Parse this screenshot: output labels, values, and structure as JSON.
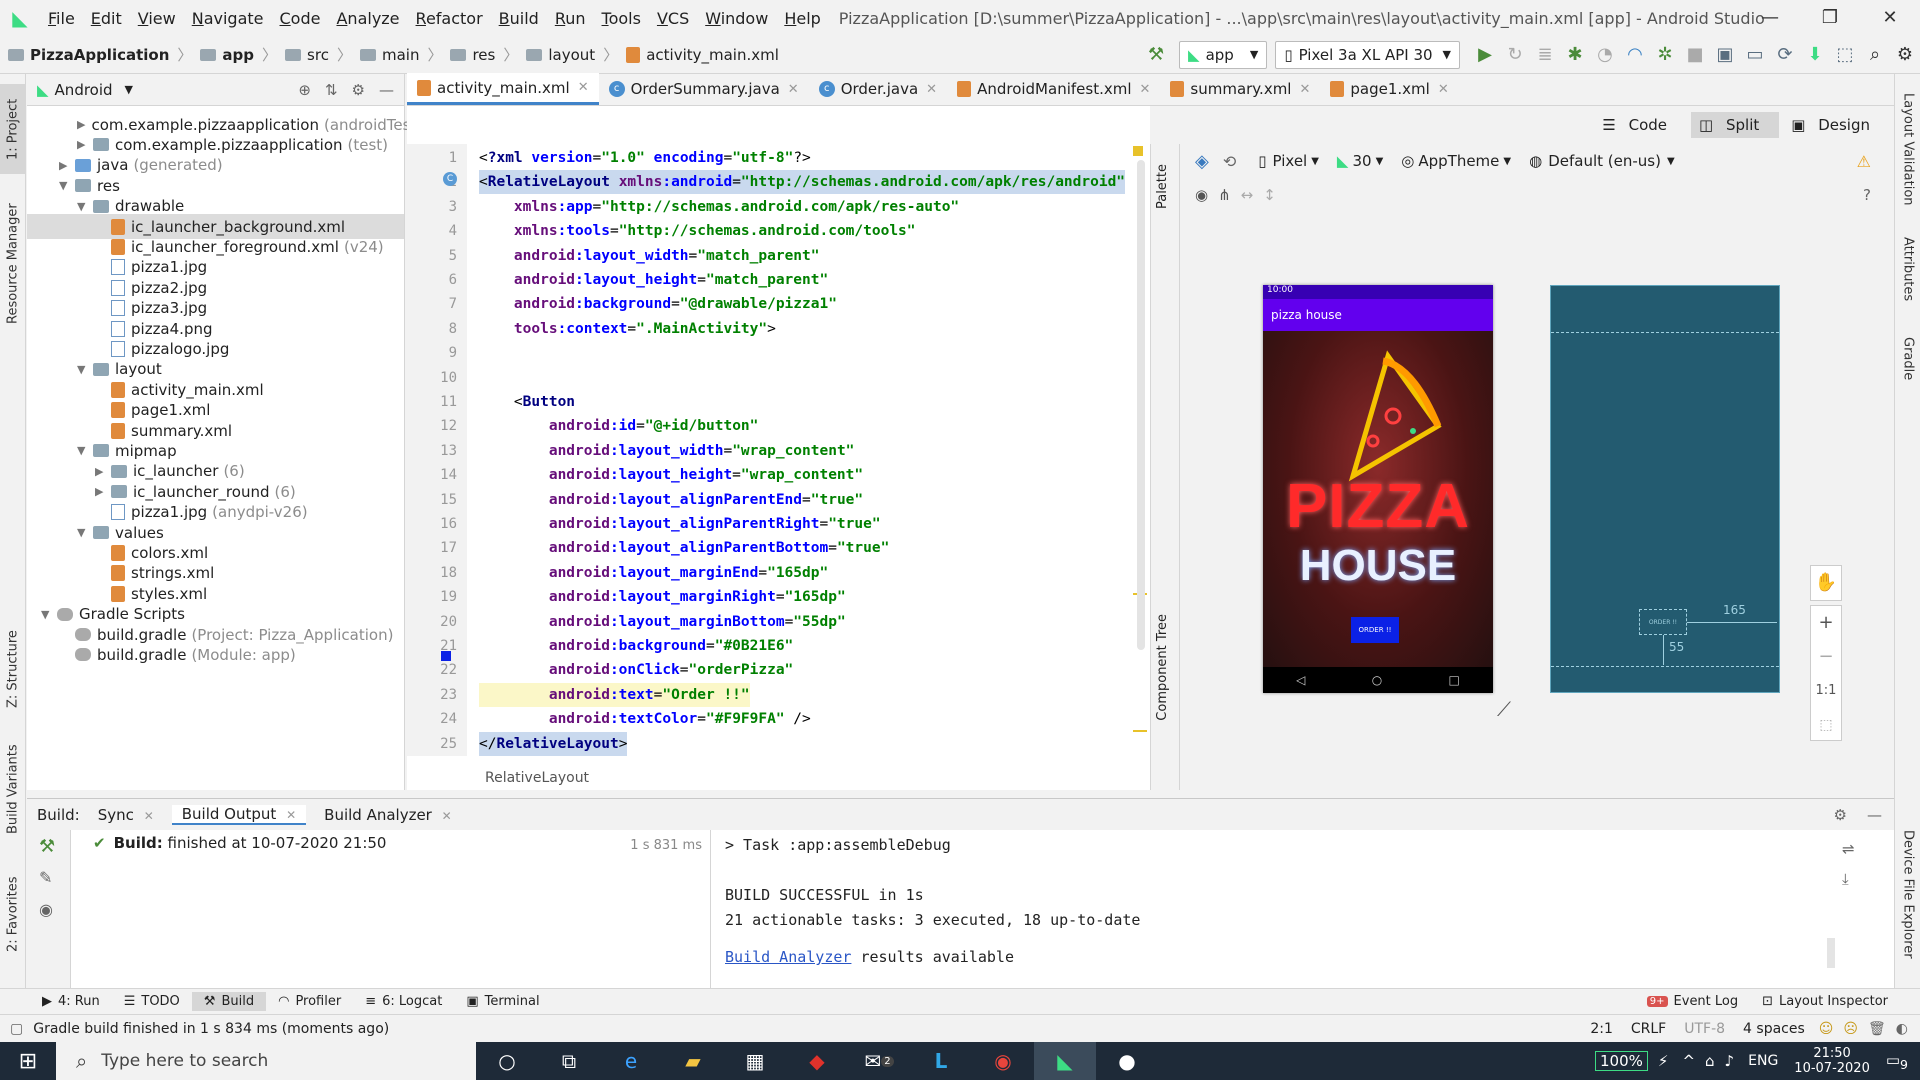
{
  "window": {
    "title": "PizzaApplication [D:\\summer\\PizzaApplication] - ...\\app\\src\\main\\res\\layout\\activity_main.xml [app] - Android Studio"
  },
  "menu": [
    "File",
    "Edit",
    "View",
    "Navigate",
    "Code",
    "Analyze",
    "Refactor",
    "Build",
    "Run",
    "Tools",
    "VCS",
    "Window",
    "Help"
  ],
  "breadcrumb": [
    "PizzaApplication",
    "app",
    "src",
    "main",
    "res",
    "layout",
    "activity_main.xml"
  ],
  "toolbar": {
    "run_config": "app",
    "device": "Pixel 3a XL API 30"
  },
  "project_panel": {
    "view": "Android",
    "tree": [
      {
        "label": "com.example.pizzaapplication",
        "hint": "(androidTest)",
        "indent": 1,
        "arrow": "▶",
        "type": "pkg"
      },
      {
        "label": "com.example.pizzaapplication",
        "hint": "(test)",
        "indent": 1,
        "arrow": "▶",
        "type": "pkg"
      },
      {
        "label": "java",
        "hint": "(generated)",
        "indent": 0,
        "arrow": "▶",
        "type": "jv"
      },
      {
        "label": "res",
        "hint": "",
        "indent": 0,
        "arrow": "▼",
        "type": "pkg"
      },
      {
        "label": "drawable",
        "hint": "",
        "indent": 1,
        "arrow": "▼",
        "type": "pkg"
      },
      {
        "label": "ic_launcher_background.xml",
        "hint": "",
        "indent": 2,
        "arrow": "",
        "type": "xml",
        "selected": true
      },
      {
        "label": "ic_launcher_foreground.xml",
        "hint": "(v24)",
        "indent": 2,
        "arrow": "",
        "type": "xml"
      },
      {
        "label": "pizza1.jpg",
        "hint": "",
        "indent": 2,
        "arrow": "",
        "type": "img"
      },
      {
        "label": "pizza2.jpg",
        "hint": "",
        "indent": 2,
        "arrow": "",
        "type": "img"
      },
      {
        "label": "pizza3.jpg",
        "hint": "",
        "indent": 2,
        "arrow": "",
        "type": "img"
      },
      {
        "label": "pizza4.png",
        "hint": "",
        "indent": 2,
        "arrow": "",
        "type": "img"
      },
      {
        "label": "pizzalogo.jpg",
        "hint": "",
        "indent": 2,
        "arrow": "",
        "type": "img"
      },
      {
        "label": "layout",
        "hint": "",
        "indent": 1,
        "arrow": "▼",
        "type": "pkg"
      },
      {
        "label": "activity_main.xml",
        "hint": "",
        "indent": 2,
        "arrow": "",
        "type": "xml"
      },
      {
        "label": "page1.xml",
        "hint": "",
        "indent": 2,
        "arrow": "",
        "type": "xml"
      },
      {
        "label": "summary.xml",
        "hint": "",
        "indent": 2,
        "arrow": "",
        "type": "xml"
      },
      {
        "label": "mipmap",
        "hint": "",
        "indent": 1,
        "arrow": "▼",
        "type": "pkg"
      },
      {
        "label": "ic_launcher",
        "hint": "(6)",
        "indent": 2,
        "arrow": "▶",
        "type": "pkg"
      },
      {
        "label": "ic_launcher_round",
        "hint": "(6)",
        "indent": 2,
        "arrow": "▶",
        "type": "pkg"
      },
      {
        "label": "pizza1.jpg",
        "hint": "(anydpi-v26)",
        "indent": 2,
        "arrow": "",
        "type": "img"
      },
      {
        "label": "values",
        "hint": "",
        "indent": 1,
        "arrow": "▼",
        "type": "pkg"
      },
      {
        "label": "colors.xml",
        "hint": "",
        "indent": 2,
        "arrow": "",
        "type": "xml"
      },
      {
        "label": "strings.xml",
        "hint": "",
        "indent": 2,
        "arrow": "",
        "type": "xml"
      },
      {
        "label": "styles.xml",
        "hint": "",
        "indent": 2,
        "arrow": "",
        "type": "xml"
      },
      {
        "label": "Gradle Scripts",
        "hint": "",
        "indent": -1,
        "arrow": "▼",
        "type": "gr"
      },
      {
        "label": "build.gradle",
        "hint": "(Project: Pizza_Application)",
        "indent": 0,
        "arrow": "",
        "type": "gr"
      },
      {
        "label": "build.gradle",
        "hint": "(Module: app)",
        "indent": 0,
        "arrow": "",
        "type": "gr"
      }
    ]
  },
  "editor_tabs": [
    {
      "label": "activity_main.xml",
      "active": true,
      "icon": "xml"
    },
    {
      "label": "OrderSummary.java",
      "active": false,
      "icon": "c"
    },
    {
      "label": "Order.java",
      "active": false,
      "icon": "c"
    },
    {
      "label": "AndroidManifest.xml",
      "active": false,
      "icon": "xml"
    },
    {
      "label": "summary.xml",
      "active": false,
      "icon": "xml"
    },
    {
      "label": "page1.xml",
      "active": false,
      "icon": "xml"
    }
  ],
  "view_modes": [
    "Code",
    "Split",
    "Design"
  ],
  "code_lines": [
    "<?xml version=\"1.0\" encoding=\"utf-8\"?>",
    "<RelativeLayout xmlns:android=\"http://schemas.android.com/apk/res/android\"",
    "    xmlns:app=\"http://schemas.android.com/apk/res-auto\"",
    "    xmlns:tools=\"http://schemas.android.com/tools\"",
    "    android:layout_width=\"match_parent\"",
    "    android:layout_height=\"match_parent\"",
    "    android:background=\"@drawable/pizza1\"",
    "    tools:context=\".MainActivity\">",
    "",
    "",
    "    <Button",
    "        android:id=\"@+id/button\"",
    "        android:layout_width=\"wrap_content\"",
    "        android:layout_height=\"wrap_content\"",
    "        android:layout_alignParentEnd=\"true\"",
    "        android:layout_alignParentRight=\"true\"",
    "        android:layout_alignParentBottom=\"true\"",
    "        android:layout_marginEnd=\"165dp\"",
    "        android:layout_marginRight=\"165dp\"",
    "        android:layout_marginBottom=\"55dp\"",
    "        android:background=\"#0B21E6\"",
    "        android:onClick=\"orderPizza\"",
    "        android:text=\"Order !!\"",
    "        android:textColor=\"#F9F9FA\" />",
    "</RelativeLayout>"
  ],
  "code_status": "RelativeLayout",
  "design": {
    "palette": "Palette",
    "component_tree": "Component Tree",
    "device": "Pixel",
    "api": "30",
    "theme": "AppTheme",
    "locale": "Default (en-us)",
    "zoom_ratio": "1:1"
  },
  "preview": {
    "time": "10:00",
    "app_title": "pizza house",
    "line1": "PIZZA",
    "line2": "HOUSE",
    "button": "ORDER !!"
  },
  "blueprint": {
    "margin_end": "165",
    "margin_bottom": "55",
    "button": "ORDER !!"
  },
  "build_panel": {
    "label": "Build:",
    "tabs": [
      "Sync",
      "Build Output",
      "Build Analyzer"
    ],
    "status_bold": "Build:",
    "status": "finished at 10-07-2020 21:50",
    "duration": "1 s 831 ms",
    "output": [
      "> Task :app:assembleDebug",
      "",
      "BUILD SUCCESSFUL in 1s",
      "21 actionable tasks: 3 executed, 18 up-to-date",
      ""
    ],
    "analyzer_link": "Build Analyzer",
    "analyzer_rest": " results available"
  },
  "tool_tabs": [
    "4: Run",
    "TODO",
    "Build",
    "Profiler",
    "6: Logcat",
    "Terminal"
  ],
  "tool_tabs_right": [
    "Event Log",
    "Layout Inspector"
  ],
  "event_badge": "9+",
  "status": {
    "message": "Gradle build finished in 1 s 834 ms (moments ago)",
    "position": "2:1",
    "line_sep": "CRLF",
    "encoding": "UTF-8",
    "indent": "4 spaces"
  },
  "left_stripe": [
    "1: Project",
    "Resource Manager",
    "Z: Structure",
    "Build Variants",
    "2: Favorites"
  ],
  "right_stripe": [
    "Layout Validation",
    "Attributes",
    "Gradle",
    "Device File Explorer"
  ],
  "taskbar": {
    "search": "Type here to search",
    "battery": "100%",
    "lang": "ENG",
    "time": "21:50",
    "date": "10-07-2020",
    "notif": "9",
    "mail_badge": "2"
  }
}
